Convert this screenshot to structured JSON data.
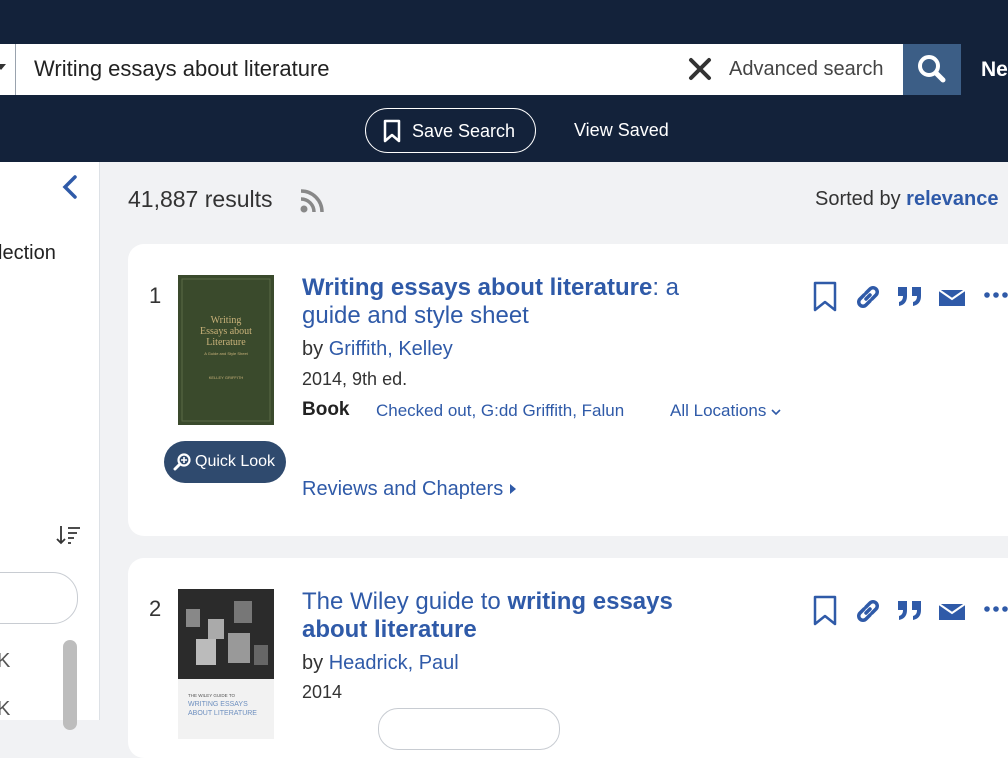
{
  "search": {
    "query": "Writing essays about literature",
    "clear_label": "✕",
    "advanced_label": "Advanced search",
    "nav_partial": "Ne"
  },
  "subnav": {
    "save_search_label": "Save Search",
    "view_saved_label": "View Saved"
  },
  "sidebar": {
    "label_partial": "lection",
    "k1": "K",
    "k2": "K"
  },
  "results": {
    "count": "41,887 results",
    "sorted_prefix": "Sorted by",
    "sorted_value": "relevance",
    "items": [
      {
        "number": "1",
        "title_bold": "Writing essays about literature",
        "title_rest": ": a guide and style sheet",
        "by": "by",
        "author": "Griffith, Kelley",
        "date": "2014, 9th ed.",
        "format": "Book",
        "availability": "Checked out, G:dd Griffith, Falun",
        "all_locations": "All Locations",
        "quick_look": "Quick Look",
        "reviews": "Reviews and Chapters",
        "cover_text": [
          "Writing",
          "Essays about",
          "Literature",
          "A Guide and Style Sheet",
          "KELLEY GRIFFITH"
        ]
      },
      {
        "number": "2",
        "title_pre": "The Wiley guide to ",
        "title_bold": "writing essays about literature",
        "by": "by",
        "author": "Headrick, Paul",
        "date": "2014",
        "cover_text": [
          "THE WILEY GUIDE TO",
          "WRITING ESSAYS",
          "ABOUT LITERATURE"
        ]
      }
    ]
  },
  "colors": {
    "header": "#13223a",
    "accent": "#2f5aa8",
    "search_button": "#3c5e86"
  },
  "icons": [
    "search-icon",
    "close-icon",
    "bookmark-icon",
    "link-icon",
    "quote-icon",
    "mail-icon",
    "more-icon",
    "rss-icon",
    "chevron-left-icon",
    "sort-icon",
    "zoom-icon"
  ]
}
